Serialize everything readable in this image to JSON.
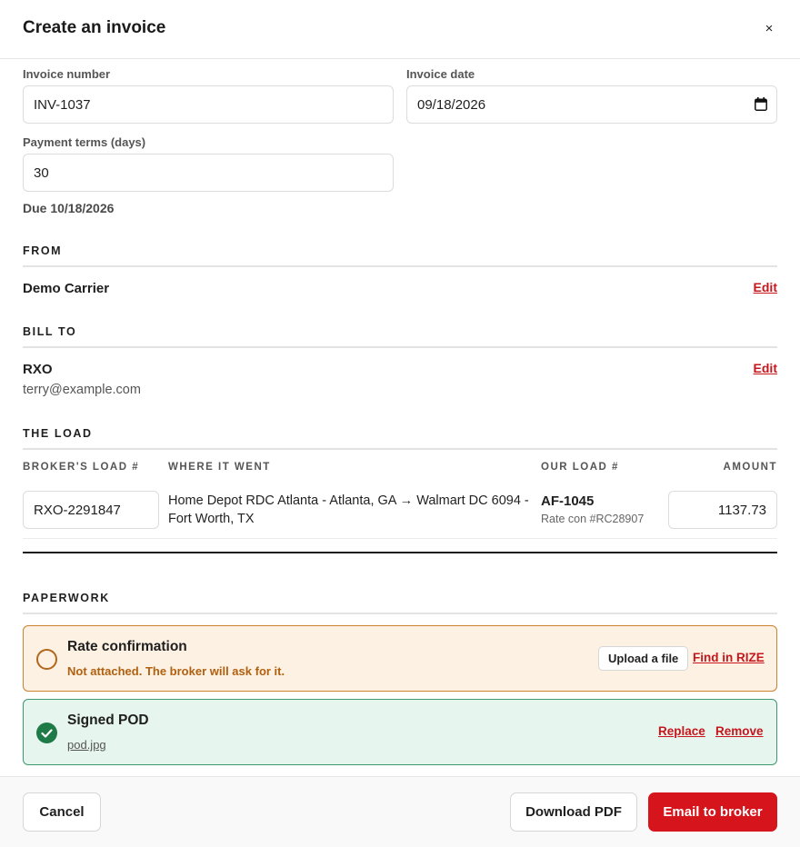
{
  "header": {
    "title": "Create an invoice",
    "close_label": "×"
  },
  "fields": {
    "invoice_number": {
      "label": "Invoice number",
      "value": "INV-1037"
    },
    "invoice_date": {
      "label": "Invoice date",
      "value": "09/18/2026"
    },
    "payment_terms": {
      "label": "Payment terms (days)",
      "value": "30"
    },
    "due_text": "Due 10/18/2026"
  },
  "from": {
    "section": "FROM",
    "name": "Demo Carrier",
    "edit_label": "Edit"
  },
  "bill_to": {
    "section": "BILL TO",
    "name": "RXO",
    "email": "terry@example.com",
    "edit_label": "Edit"
  },
  "load": {
    "section": "THE LOAD",
    "columns": [
      "BROKER'S LOAD #",
      "WHERE IT WENT",
      "OUR LOAD #",
      "AMOUNT"
    ],
    "row": {
      "broker_load": "RXO-2291847",
      "route": "Home Depot RDC Atlanta - Atlanta, GA → Walmart DC 6094 - Fort Worth, TX",
      "our_load": "AF-1045",
      "rate_con": "Rate con #RC28907",
      "amount": "1137.73"
    }
  },
  "paperwork": {
    "section": "PAPERWORK",
    "rate_confirmation": {
      "title": "Rate confirmation",
      "status": "Not attached. The broker will ask for it.",
      "upload_label": "Upload a file",
      "find_label": "Find in RIZE"
    },
    "signed_pod": {
      "title": "Signed POD",
      "file": "pod.jpg",
      "replace_label": "Replace",
      "remove_label": "Remove"
    }
  },
  "footer": {
    "cancel_label": "Cancel",
    "download_label": "Download PDF",
    "email_label": "Email to broker"
  },
  "colors": {
    "accent": "#d6141b",
    "warning_bg": "#fdf1e3",
    "warning_border": "#c9822d",
    "success_bg": "#e6f5ee",
    "success_icon": "#1e7a47"
  },
  "icons": {
    "close": "close-icon",
    "date": "calendar-icon",
    "empty_status": "empty-circle-icon",
    "done_status": "check-circle-icon"
  }
}
